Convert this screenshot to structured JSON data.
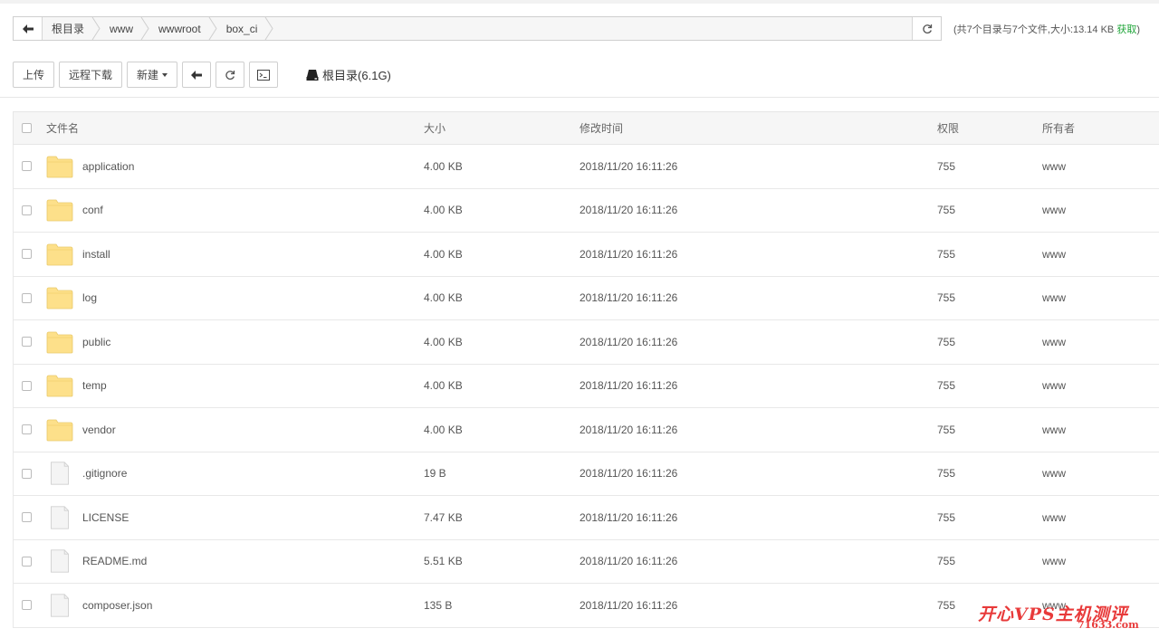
{
  "path": {
    "crumbs": [
      "根目录",
      "www",
      "wwwroot",
      "box_ci"
    ]
  },
  "summary": {
    "text": "(共7个目录与7个文件,大小:13.14 KB ",
    "get_label": "获取",
    "close": ")"
  },
  "toolbar": {
    "upload": "上传",
    "remote_download": "远程下载",
    "new": "新建",
    "disk_label": "根目录(6.1G)"
  },
  "table": {
    "headers": {
      "name": "文件名",
      "size": "大小",
      "mtime": "修改时间",
      "perm": "权限",
      "owner": "所有者"
    },
    "rows": [
      {
        "type": "folder",
        "name": "application",
        "size": "4.00 KB",
        "mtime": "2018/11/20 16:11:26",
        "perm": "755",
        "owner": "www"
      },
      {
        "type": "folder",
        "name": "conf",
        "size": "4.00 KB",
        "mtime": "2018/11/20 16:11:26",
        "perm": "755",
        "owner": "www"
      },
      {
        "type": "folder",
        "name": "install",
        "size": "4.00 KB",
        "mtime": "2018/11/20 16:11:26",
        "perm": "755",
        "owner": "www"
      },
      {
        "type": "folder",
        "name": "log",
        "size": "4.00 KB",
        "mtime": "2018/11/20 16:11:26",
        "perm": "755",
        "owner": "www"
      },
      {
        "type": "folder",
        "name": "public",
        "size": "4.00 KB",
        "mtime": "2018/11/20 16:11:26",
        "perm": "755",
        "owner": "www"
      },
      {
        "type": "folder",
        "name": "temp",
        "size": "4.00 KB",
        "mtime": "2018/11/20 16:11:26",
        "perm": "755",
        "owner": "www"
      },
      {
        "type": "folder",
        "name": "vendor",
        "size": "4.00 KB",
        "mtime": "2018/11/20 16:11:26",
        "perm": "755",
        "owner": "www"
      },
      {
        "type": "file",
        "name": ".gitignore",
        "size": "19 B",
        "mtime": "2018/11/20 16:11:26",
        "perm": "755",
        "owner": "www"
      },
      {
        "type": "file",
        "name": "LICENSE",
        "size": "7.47 KB",
        "mtime": "2018/11/20 16:11:26",
        "perm": "755",
        "owner": "www"
      },
      {
        "type": "file",
        "name": "README.md",
        "size": "5.51 KB",
        "mtime": "2018/11/20 16:11:26",
        "perm": "755",
        "owner": "www"
      },
      {
        "type": "file",
        "name": "composer.json",
        "size": "135 B",
        "mtime": "2018/11/20 16:11:26",
        "perm": "755",
        "owner": "www"
      }
    ]
  },
  "watermark": {
    "text": "开心VPS主机测评",
    "url": "71633.com"
  },
  "colors": {
    "folder": "#fde08a",
    "accent_green": "#20a53a",
    "watermark_red": "#e83a3a"
  }
}
